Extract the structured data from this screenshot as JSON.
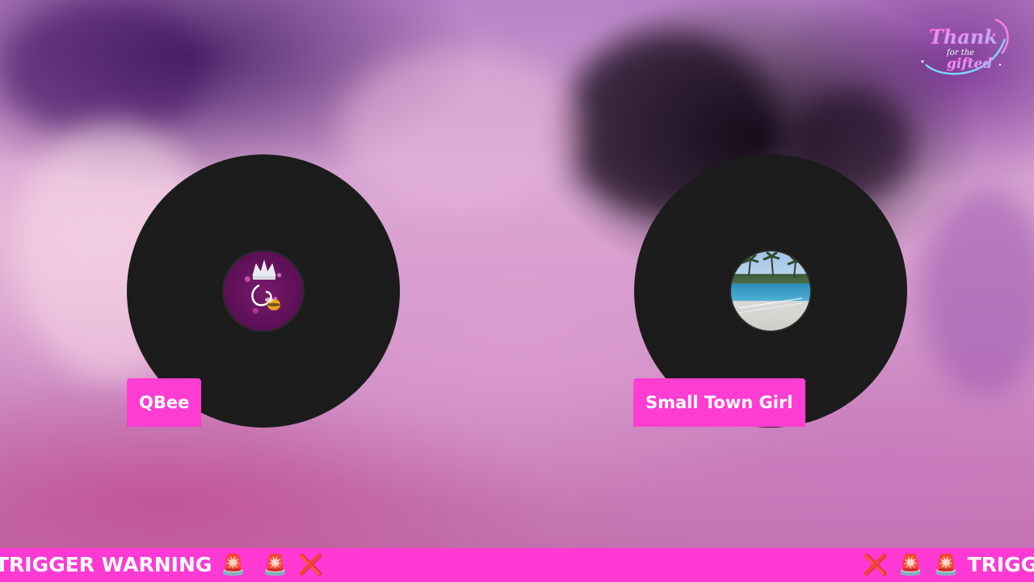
{
  "logo": {
    "text_line1": "Thank",
    "text_line2": "for the",
    "text_line3": "gifted"
  },
  "participants": [
    {
      "name": "QBee",
      "avatar": "qbee-crown-glitter-avatar"
    },
    {
      "name": "Small Town Girl",
      "avatar": "pool-palm-trees-avatar"
    }
  ],
  "ticker": {
    "segment_a_text": "TRIGGER WARNING",
    "segment_b_text": "TRIGGER",
    "icons": [
      "siren-icon",
      "x-mark-icon"
    ]
  },
  "colors": {
    "accent_pink": "#ff3dd2",
    "vinyl_black": "#1c1c1c",
    "ticker_pink": "#ff39d4"
  }
}
